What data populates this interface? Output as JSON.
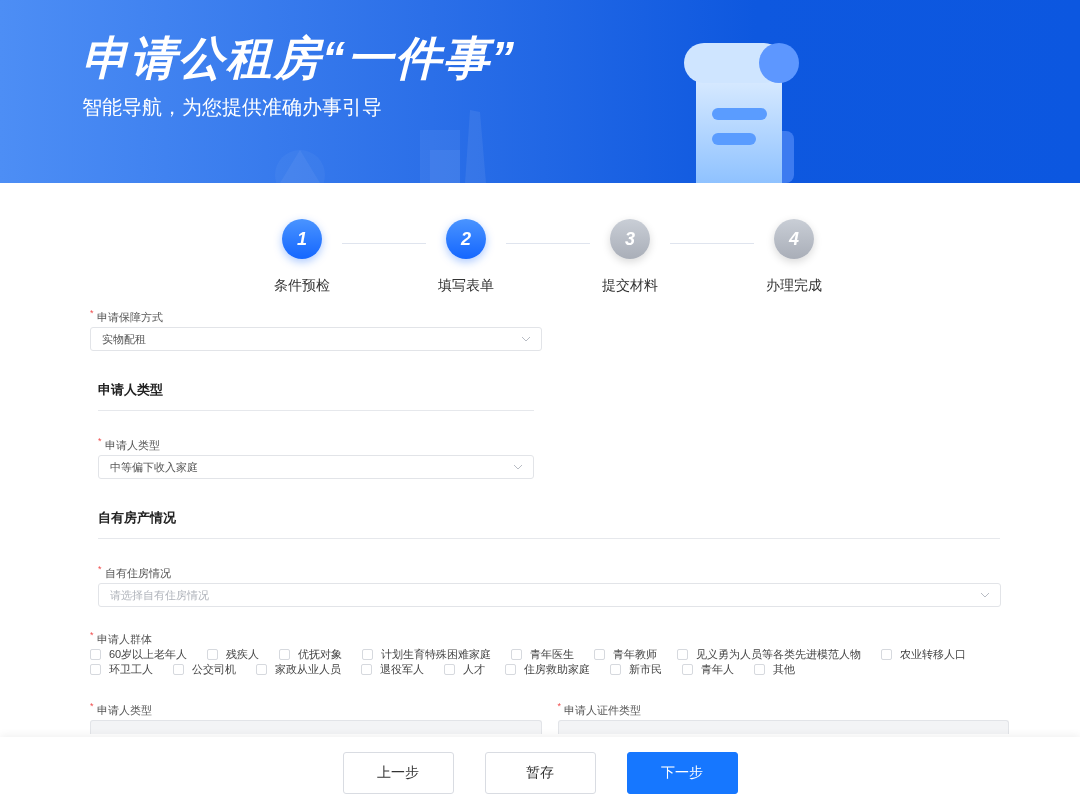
{
  "banner": {
    "title": "申请公租房“一件事”",
    "subtitle": "智能导航，为您提供准确办事引导"
  },
  "steps": [
    {
      "number": "1",
      "label": "条件预检",
      "active": true
    },
    {
      "number": "2",
      "label": "填写表单",
      "active": true
    },
    {
      "number": "3",
      "label": "提交材料",
      "active": false
    },
    {
      "number": "4",
      "label": "办理完成",
      "active": false
    }
  ],
  "form": {
    "guarantee_method": {
      "label": "申请保障方式",
      "required_mark": "*",
      "value": "实物配租"
    },
    "section_1": {
      "title": "申请人类型",
      "field": {
        "label": "申请人类型",
        "required_mark": "*",
        "value": "中等偏下收入家庭"
      }
    },
    "section_2": {
      "title": "自有房产情况",
      "field": {
        "label": "自有住房情况",
        "required_mark": "*",
        "placeholder": "请选择自有住房情况"
      }
    },
    "applicant_group": {
      "label": "申请人群体",
      "required_mark": "*",
      "options": [
        {
          "label": "60岁以上老年人",
          "checked": false
        },
        {
          "label": "残疾人",
          "checked": false
        },
        {
          "label": "优抚对象",
          "checked": false
        },
        {
          "label": "计划生育特殊困难家庭",
          "checked": false
        },
        {
          "label": "青年医生",
          "checked": false
        },
        {
          "label": "青年教师",
          "checked": false
        },
        {
          "label": "见义勇为人员等各类先进模范人物",
          "checked": false
        },
        {
          "label": "农业转移人口",
          "checked": false
        },
        {
          "label": "环卫工人",
          "checked": false
        },
        {
          "label": "公交司机",
          "checked": false
        },
        {
          "label": "家政从业人员",
          "checked": false
        },
        {
          "label": "退役军人",
          "checked": false
        },
        {
          "label": "人才",
          "checked": false
        },
        {
          "label": "住房救助家庭",
          "checked": false
        },
        {
          "label": "新市民",
          "checked": false
        },
        {
          "label": "青年人",
          "checked": false
        },
        {
          "label": "其他",
          "checked": false
        }
      ]
    },
    "bottom_fields": [
      {
        "label": "申请人类型",
        "required_mark": "*"
      },
      {
        "label": "申请人证件类型",
        "required_mark": "*"
      }
    ]
  },
  "buttons": [
    {
      "label": "上一步",
      "primary": false
    },
    {
      "label": "暂存",
      "primary": false
    },
    {
      "label": "下一步",
      "primary": true
    }
  ]
}
